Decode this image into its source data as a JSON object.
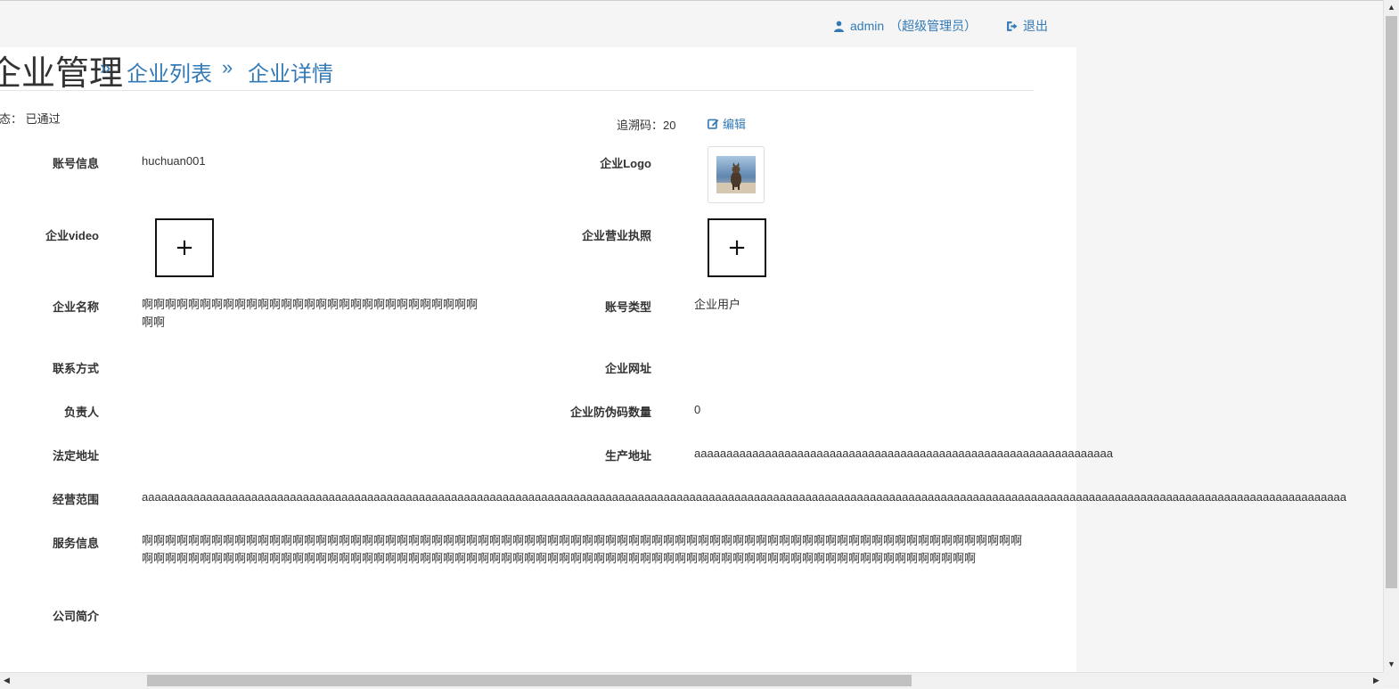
{
  "topbar": {
    "user_name": "admin",
    "user_role": "（超级管理员）",
    "logout_label": "退出"
  },
  "breadcrumb": {
    "root": "企业管理",
    "sep": "»",
    "list": "企业列表",
    "detail": "企业详情"
  },
  "header": {
    "status_label": "状态：",
    "status_value": "已通过",
    "trace_code": "追溯码：20",
    "edit_label": "编辑"
  },
  "fields": {
    "account_info": {
      "label": "账号信息",
      "value": "huchuan001"
    },
    "company_logo": {
      "label": "企业Logo"
    },
    "company_video": {
      "label": "企业video",
      "upload": "+"
    },
    "business_license": {
      "label": "企业营业执照",
      "upload": "+"
    },
    "company_name": {
      "label": "企业名称",
      "value": "啊啊啊啊啊啊啊啊啊啊啊啊啊啊啊啊啊啊啊啊啊啊啊啊啊啊啊啊啊啊啊"
    },
    "account_type": {
      "label": "账号类型",
      "value": "企业用户"
    },
    "contact": {
      "label": "联系方式",
      "value": ""
    },
    "website": {
      "label": "企业网址",
      "value": ""
    },
    "person_in_charge": {
      "label": "负责人",
      "value": ""
    },
    "anti_fake_count": {
      "label": "企业防伪码数量",
      "value": "0"
    },
    "legal_address": {
      "label": "法定地址",
      "value": ""
    },
    "production_address": {
      "label": "生产地址",
      "value": "aaaaaaaaaaaaaaaaaaaaaaaaaaaaaaaaaaaaaaaaaaaaaaaaaaaaaaaaaaaaaaaaa"
    },
    "business_scope": {
      "label": "经营范围",
      "value": "aaaaaaaaaaaaaaaaaaaaaaaaaaaaaaaaaaaaaaaaaaaaaaaaaaaaaaaaaaaaaaaaaaaaaaaaaaaaaaaaaaaaaaaaaaaaaaaaaaaaaaaaaaaaaaaaaaaaaaaaaaaaaaaaaaaaaaaaaaaaaaaaaaaaaaaaaaaaaaaaaaaaaaaaaaaaaaaaaaaaaaaaaaa"
    },
    "service_info": {
      "label": "服务信息",
      "value": "啊啊啊啊啊啊啊啊啊啊啊啊啊啊啊啊啊啊啊啊啊啊啊啊啊啊啊啊啊啊啊啊啊啊啊啊啊啊啊啊啊啊啊啊啊啊啊啊啊啊啊啊啊啊啊啊啊啊啊啊啊啊啊啊啊啊啊啊啊啊啊啊啊啊啊啊啊啊啊啊啊啊啊啊啊啊啊啊啊啊啊啊啊啊啊啊啊啊啊啊啊啊啊啊啊啊啊啊啊啊啊啊啊啊啊啊啊啊啊啊啊啊啊啊啊啊啊啊啊啊啊啊啊啊啊啊啊啊啊啊啊啊啊啊啊啊啊啊"
    },
    "company_intro": {
      "label": "公司简介",
      "value": ""
    }
  },
  "colors": {
    "link": "#337ab7",
    "text": "#333333"
  }
}
